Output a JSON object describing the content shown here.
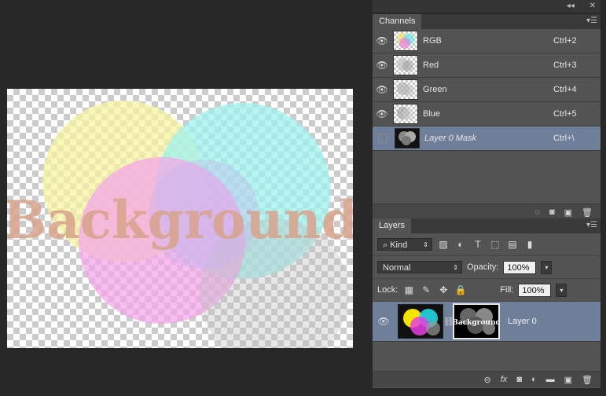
{
  "panel_bar": {
    "collapse": "◂◂",
    "close": "✕"
  },
  "channels": {
    "tab": "Channels",
    "items": [
      {
        "name": "RGB",
        "shortcut": "Ctrl+2"
      },
      {
        "name": "Red",
        "shortcut": "Ctrl+3"
      },
      {
        "name": "Green",
        "shortcut": "Ctrl+4"
      },
      {
        "name": "Blue",
        "shortcut": "Ctrl+5"
      },
      {
        "name": "Layer 0 Mask",
        "shortcut": "Ctrl+\\"
      }
    ]
  },
  "layers": {
    "tab": "Layers",
    "filter": "Kind",
    "blend_mode": "Normal",
    "opacity_label": "Opacity:",
    "opacity": "100%",
    "lock_label": "Lock:",
    "fill_label": "Fill:",
    "fill": "100%",
    "layer_name": "Layer 0",
    "fx": "fx"
  },
  "canvas": {
    "text": "Background"
  },
  "colors": {
    "panel": "#535353",
    "selected": "#6f7f99",
    "workspace": "#282828"
  }
}
